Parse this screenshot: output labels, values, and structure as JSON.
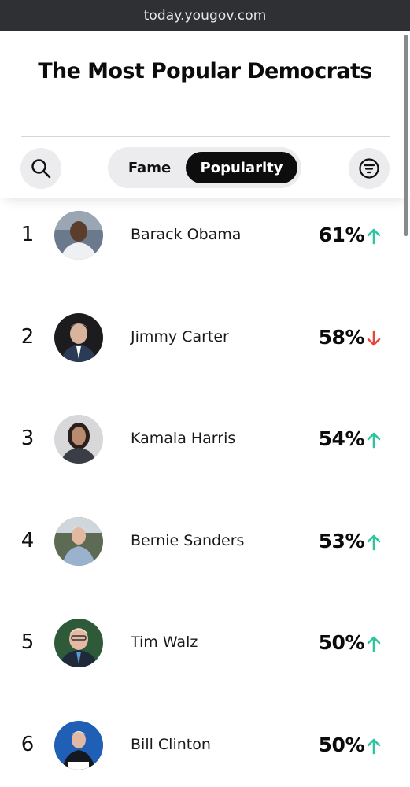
{
  "browser": {
    "url": "today.yougov.com"
  },
  "page": {
    "title": "The Most Popular Democrats"
  },
  "toggle": {
    "fame_label": "Fame",
    "popularity_label": "Popularity",
    "selected": "Popularity"
  },
  "icons": {
    "search": "search-icon",
    "filter": "filter-icon",
    "up": "arrow-up-icon",
    "down": "arrow-down-icon"
  },
  "colors": {
    "up": "#2ec4a0",
    "down": "#e8463c",
    "active_tab": "#0d0d0d"
  },
  "ranking": [
    {
      "rank": "1",
      "name": "Barack Obama",
      "popularity": "61%",
      "trend": "up"
    },
    {
      "rank": "2",
      "name": "Jimmy Carter",
      "popularity": "58%",
      "trend": "down"
    },
    {
      "rank": "3",
      "name": "Kamala Harris",
      "popularity": "54%",
      "trend": "up"
    },
    {
      "rank": "4",
      "name": "Bernie Sanders",
      "popularity": "53%",
      "trend": "up"
    },
    {
      "rank": "5",
      "name": "Tim Walz",
      "popularity": "50%",
      "trend": "up"
    },
    {
      "rank": "6",
      "name": "Bill Clinton",
      "popularity": "50%",
      "trend": "up"
    }
  ]
}
